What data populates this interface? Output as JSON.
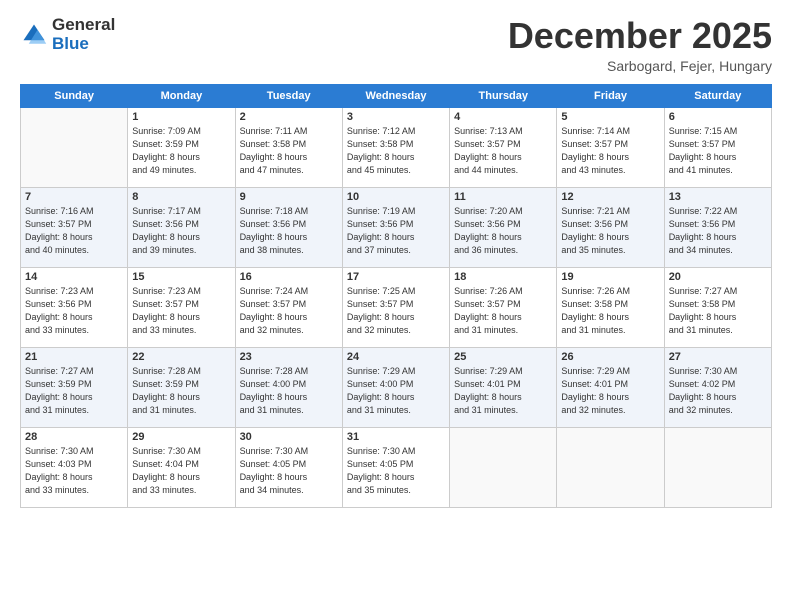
{
  "logo": {
    "general": "General",
    "blue": "Blue"
  },
  "header": {
    "month": "December 2025",
    "location": "Sarbogard, Fejer, Hungary"
  },
  "days_of_week": [
    "Sunday",
    "Monday",
    "Tuesday",
    "Wednesday",
    "Thursday",
    "Friday",
    "Saturday"
  ],
  "weeks": [
    [
      {
        "day": "",
        "info": ""
      },
      {
        "day": "1",
        "info": "Sunrise: 7:09 AM\nSunset: 3:59 PM\nDaylight: 8 hours\nand 49 minutes."
      },
      {
        "day": "2",
        "info": "Sunrise: 7:11 AM\nSunset: 3:58 PM\nDaylight: 8 hours\nand 47 minutes."
      },
      {
        "day": "3",
        "info": "Sunrise: 7:12 AM\nSunset: 3:58 PM\nDaylight: 8 hours\nand 45 minutes."
      },
      {
        "day": "4",
        "info": "Sunrise: 7:13 AM\nSunset: 3:57 PM\nDaylight: 8 hours\nand 44 minutes."
      },
      {
        "day": "5",
        "info": "Sunrise: 7:14 AM\nSunset: 3:57 PM\nDaylight: 8 hours\nand 43 minutes."
      },
      {
        "day": "6",
        "info": "Sunrise: 7:15 AM\nSunset: 3:57 PM\nDaylight: 8 hours\nand 41 minutes."
      }
    ],
    [
      {
        "day": "7",
        "info": "Sunrise: 7:16 AM\nSunset: 3:57 PM\nDaylight: 8 hours\nand 40 minutes."
      },
      {
        "day": "8",
        "info": "Sunrise: 7:17 AM\nSunset: 3:56 PM\nDaylight: 8 hours\nand 39 minutes."
      },
      {
        "day": "9",
        "info": "Sunrise: 7:18 AM\nSunset: 3:56 PM\nDaylight: 8 hours\nand 38 minutes."
      },
      {
        "day": "10",
        "info": "Sunrise: 7:19 AM\nSunset: 3:56 PM\nDaylight: 8 hours\nand 37 minutes."
      },
      {
        "day": "11",
        "info": "Sunrise: 7:20 AM\nSunset: 3:56 PM\nDaylight: 8 hours\nand 36 minutes."
      },
      {
        "day": "12",
        "info": "Sunrise: 7:21 AM\nSunset: 3:56 PM\nDaylight: 8 hours\nand 35 minutes."
      },
      {
        "day": "13",
        "info": "Sunrise: 7:22 AM\nSunset: 3:56 PM\nDaylight: 8 hours\nand 34 minutes."
      }
    ],
    [
      {
        "day": "14",
        "info": "Sunrise: 7:23 AM\nSunset: 3:56 PM\nDaylight: 8 hours\nand 33 minutes."
      },
      {
        "day": "15",
        "info": "Sunrise: 7:23 AM\nSunset: 3:57 PM\nDaylight: 8 hours\nand 33 minutes."
      },
      {
        "day": "16",
        "info": "Sunrise: 7:24 AM\nSunset: 3:57 PM\nDaylight: 8 hours\nand 32 minutes."
      },
      {
        "day": "17",
        "info": "Sunrise: 7:25 AM\nSunset: 3:57 PM\nDaylight: 8 hours\nand 32 minutes."
      },
      {
        "day": "18",
        "info": "Sunrise: 7:26 AM\nSunset: 3:57 PM\nDaylight: 8 hours\nand 31 minutes."
      },
      {
        "day": "19",
        "info": "Sunrise: 7:26 AM\nSunset: 3:58 PM\nDaylight: 8 hours\nand 31 minutes."
      },
      {
        "day": "20",
        "info": "Sunrise: 7:27 AM\nSunset: 3:58 PM\nDaylight: 8 hours\nand 31 minutes."
      }
    ],
    [
      {
        "day": "21",
        "info": "Sunrise: 7:27 AM\nSunset: 3:59 PM\nDaylight: 8 hours\nand 31 minutes."
      },
      {
        "day": "22",
        "info": "Sunrise: 7:28 AM\nSunset: 3:59 PM\nDaylight: 8 hours\nand 31 minutes."
      },
      {
        "day": "23",
        "info": "Sunrise: 7:28 AM\nSunset: 4:00 PM\nDaylight: 8 hours\nand 31 minutes."
      },
      {
        "day": "24",
        "info": "Sunrise: 7:29 AM\nSunset: 4:00 PM\nDaylight: 8 hours\nand 31 minutes."
      },
      {
        "day": "25",
        "info": "Sunrise: 7:29 AM\nSunset: 4:01 PM\nDaylight: 8 hours\nand 31 minutes."
      },
      {
        "day": "26",
        "info": "Sunrise: 7:29 AM\nSunset: 4:01 PM\nDaylight: 8 hours\nand 32 minutes."
      },
      {
        "day": "27",
        "info": "Sunrise: 7:30 AM\nSunset: 4:02 PM\nDaylight: 8 hours\nand 32 minutes."
      }
    ],
    [
      {
        "day": "28",
        "info": "Sunrise: 7:30 AM\nSunset: 4:03 PM\nDaylight: 8 hours\nand 33 minutes."
      },
      {
        "day": "29",
        "info": "Sunrise: 7:30 AM\nSunset: 4:04 PM\nDaylight: 8 hours\nand 33 minutes."
      },
      {
        "day": "30",
        "info": "Sunrise: 7:30 AM\nSunset: 4:05 PM\nDaylight: 8 hours\nand 34 minutes."
      },
      {
        "day": "31",
        "info": "Sunrise: 7:30 AM\nSunset: 4:05 PM\nDaylight: 8 hours\nand 35 minutes."
      },
      {
        "day": "",
        "info": ""
      },
      {
        "day": "",
        "info": ""
      },
      {
        "day": "",
        "info": ""
      }
    ]
  ]
}
